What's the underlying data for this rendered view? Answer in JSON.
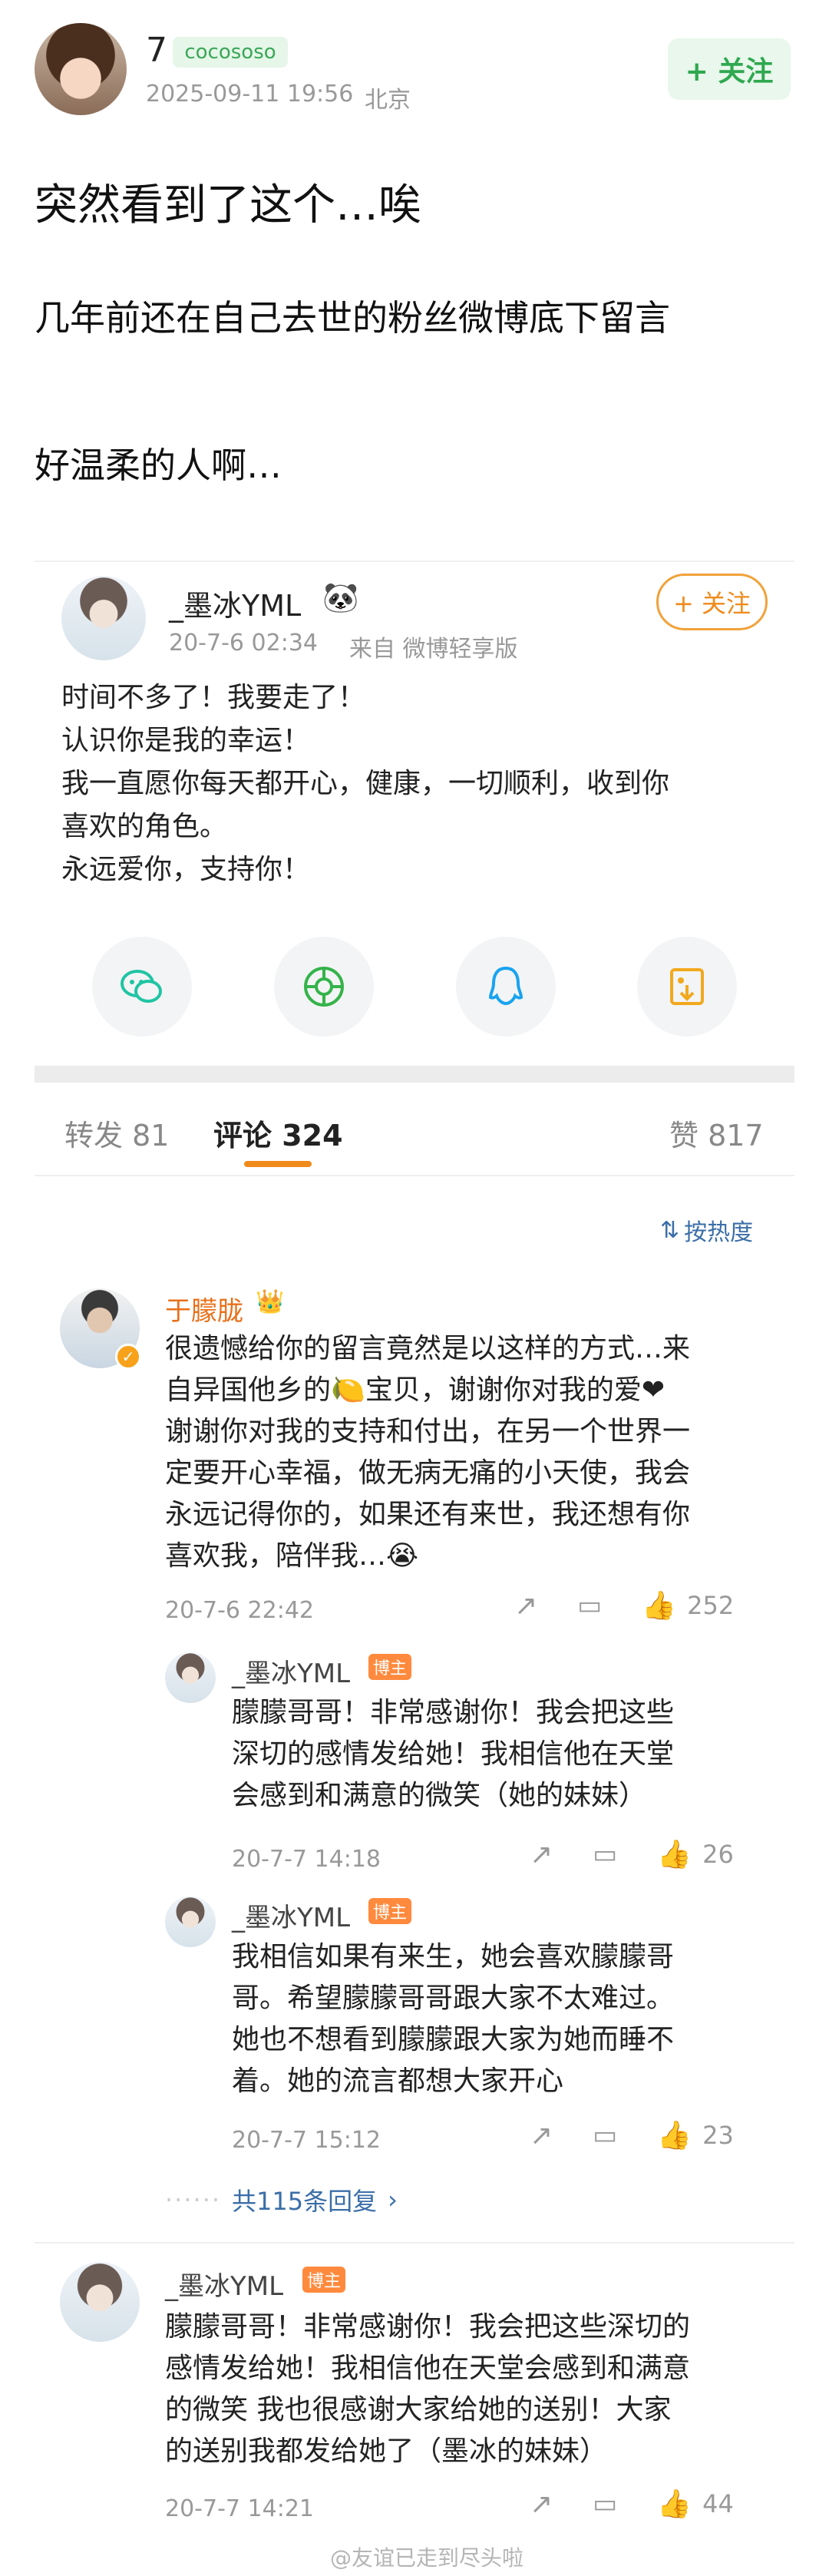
{
  "post": {
    "author": "7",
    "badge": "cocososo",
    "time": "2025-09-11 19:56",
    "location": "北京",
    "follow_label": "+ 关注",
    "lines": [
      "突然看到了这个…唉",
      "几年前还在自己去世的粉丝微博底下留言",
      "好温柔的人啊…"
    ]
  },
  "embedded": {
    "author": "_墨冰YML",
    "emoji": "🐼",
    "time": "20-7-6 02:34",
    "source": "来自 微博轻享版",
    "follow_label": "+ 关注",
    "lines": [
      "时间不多了！我要走了！",
      "认识你是我的幸运！",
      "我一直愿你每天都开心，健康，一切顺利，收到你",
      "喜欢的角色。",
      "永远爱你，支持你！"
    ]
  },
  "share_icons": [
    "wechat-icon",
    "moments-icon",
    "qq-icon",
    "save-image-icon"
  ],
  "tabs": {
    "repost": "转发 81",
    "comments": "评论 324",
    "likes": "赞 817"
  },
  "sort_label": "按热度",
  "comments": [
    {
      "author": "于朦胧",
      "lines": [
        "很遗憾给你的留言竟然是以这样的方式…来",
        "自异国他乡的🍋宝贝，谢谢你对我的爱❤",
        "谢谢你对我的支持和付出，在另一个世界一",
        "定要开心幸福，做无病无痛的小天使，我会",
        "永远记得你的，如果还有来世，我还想有你",
        "喜欢我，陪伴我…😭"
      ],
      "time": "20-7-6 22:42",
      "likes": "252",
      "replies": [
        {
          "author": "_墨冰YML",
          "badge": "博主",
          "lines": [
            "朦朦哥哥！非常感谢你！我会把这些",
            "深切的感情发给她！我相信他在天堂",
            "会感到和满意的微笑（她的妹妹）"
          ],
          "time": "20-7-7 14:18",
          "likes": "26"
        },
        {
          "author": "_墨冰YML",
          "badge": "博主",
          "lines": [
            "我相信如果有来生，她会喜欢朦朦哥",
            "哥。希望朦朦哥哥跟大家不太难过。",
            "她也不想看到朦朦跟大家为她而睡不",
            "着。她的流言都想大家开心"
          ],
          "time": "20-7-7 15:12",
          "likes": "23"
        }
      ],
      "more_replies": "共115条回复",
      "more_arrow": "›"
    },
    {
      "author": "_墨冰YML",
      "badge": "博主",
      "lines": [
        "朦朦哥哥！非常感谢你！我会把这些深切的",
        "感情发给她！我相信他在天堂会感到和满意",
        "的微笑 我也很感谢大家给她的送别！大家",
        "的送别我都发给她了（墨冰的妹妹）"
      ],
      "time": "20-7-7 14:21",
      "likes": "44"
    }
  ],
  "watermark": "@友谊已走到尽头啦"
}
